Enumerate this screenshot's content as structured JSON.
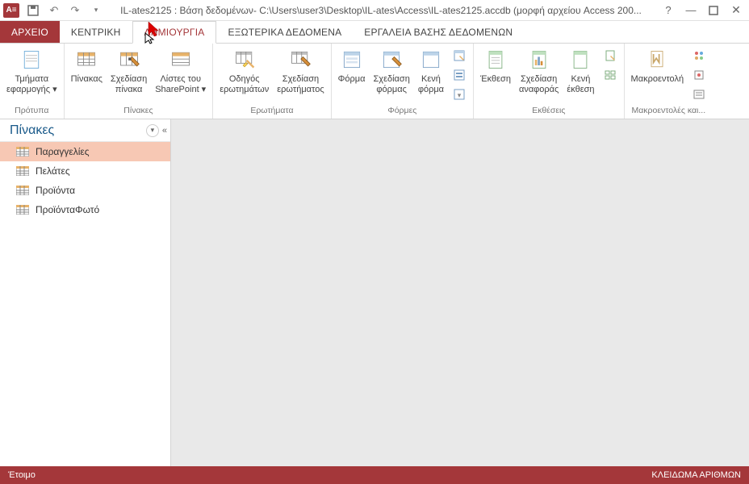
{
  "app_icon_text": "A≡",
  "title": "IL-ates2125 : Βάση δεδομένων- C:\\Users\\user3\\Desktop\\IL-ates\\Access\\IL-ates2125.accdb (μορφή αρχείου Access 200...",
  "tabs": {
    "file": "ΑΡΧΕΙΟ",
    "home": "ΚΕΝΤΡΙΚΗ",
    "create": "ΔΗΜΙΟΥΡΓΙΑ",
    "external": "ΕΞΩΤΕΡΙΚΑ ΔΕΔΟΜΕΝΑ",
    "dbtools": "ΕΡΓΑΛΕΙΑ ΒΑΣΗΣ ΔΕΔΟΜΕΝΩΝ"
  },
  "ribbon": {
    "templates": {
      "label": "Πρότυπα",
      "appparts": "Τμήματα\nεφαρμογής ▾"
    },
    "tables": {
      "label": "Πίνακες",
      "table": "Πίνακας",
      "tabledesign": "Σχεδίαση\nπίνακα",
      "sharepoint": "Λίστες του\nSharePoint ▾"
    },
    "queries": {
      "label": "Ερωτήματα",
      "wizard": "Οδηγός\nερωτημάτων",
      "design": "Σχεδίαση\nερωτήματος"
    },
    "forms": {
      "label": "Φόρμες",
      "form": "Φόρμα",
      "formdesign": "Σχεδίαση\nφόρμας",
      "blankform": "Κενή\nφόρμα"
    },
    "reports": {
      "label": "Εκθέσεις",
      "report": "Έκθεση",
      "reportdesign": "Σχεδίαση\nαναφοράς",
      "blankreport": "Κενή\nέκθεση"
    },
    "macros": {
      "label": "Μακροεντολές και...",
      "macro": "Μακροεντολή"
    }
  },
  "navpane": {
    "title": "Πίνακες",
    "items": [
      {
        "label": "Παραγγελίες",
        "selected": true
      },
      {
        "label": "Πελάτες",
        "selected": false
      },
      {
        "label": "Προϊόντα",
        "selected": false
      },
      {
        "label": "ΠροϊόνταΦωτό",
        "selected": false
      }
    ]
  },
  "status": {
    "left": "Έτοιμο",
    "right": "ΚΛΕΙΔΩΜΑ ΑΡΙΘΜΩΝ"
  }
}
